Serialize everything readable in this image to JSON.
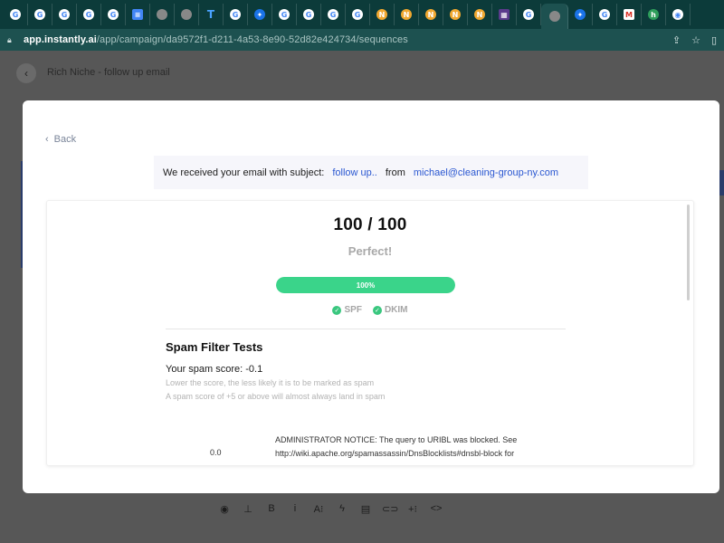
{
  "browser": {
    "tabs": [
      {
        "icon": "google-icon",
        "glyph": "G",
        "kind": "g",
        "text": ""
      },
      {
        "icon": "google-icon",
        "glyph": "G",
        "kind": "g",
        "text": ""
      },
      {
        "icon": "google-icon",
        "glyph": "G",
        "kind": "g",
        "text": ""
      },
      {
        "icon": "google-icon",
        "glyph": "G",
        "kind": "g",
        "text": ""
      },
      {
        "icon": "google-icon",
        "glyph": "G",
        "kind": "g",
        "text": ""
      },
      {
        "icon": "google-docs-icon",
        "glyph": "≡",
        "kind": "gd",
        "text": ""
      },
      {
        "icon": "generic-site-icon",
        "glyph": "",
        "kind": "gray",
        "text": ""
      },
      {
        "icon": "generic-site-icon",
        "glyph": "",
        "kind": "gray",
        "text": ""
      },
      {
        "icon": "t-letter-icon",
        "glyph": "T",
        "kind": "t",
        "text": ""
      },
      {
        "icon": "google-icon",
        "glyph": "G",
        "kind": "g",
        "text": ""
      },
      {
        "icon": "blue-gear-icon",
        "glyph": "✦",
        "kind": "blue",
        "text": ""
      },
      {
        "icon": "google-icon",
        "glyph": "G",
        "kind": "g",
        "text": ""
      },
      {
        "icon": "google-icon",
        "glyph": "G",
        "kind": "g",
        "text": ""
      },
      {
        "icon": "google-icon",
        "glyph": "G",
        "kind": "g",
        "text": ""
      },
      {
        "icon": "google-icon",
        "glyph": "G",
        "kind": "g",
        "text": ""
      },
      {
        "icon": "orange-n-icon",
        "glyph": "N",
        "kind": "orange",
        "text": ""
      },
      {
        "icon": "orange-n-icon",
        "glyph": "N",
        "kind": "orange",
        "text": ""
      },
      {
        "icon": "orange-n-icon",
        "glyph": "N",
        "kind": "orange",
        "text": ""
      },
      {
        "icon": "orange-n-icon",
        "glyph": "N",
        "kind": "orange",
        "text": ""
      },
      {
        "icon": "orange-n-icon",
        "glyph": "N",
        "kind": "orange",
        "text": ""
      },
      {
        "icon": "purple-app-icon",
        "glyph": "▦",
        "kind": "purple",
        "text": ""
      },
      {
        "icon": "google-icon",
        "glyph": "G",
        "kind": "g",
        "text": ""
      },
      {
        "icon": "instantly-icon",
        "glyph": "",
        "kind": "gray",
        "text": "",
        "active": true
      },
      {
        "icon": "blue-gear-icon",
        "glyph": "✦",
        "kind": "blue",
        "text": ""
      },
      {
        "icon": "google-icon",
        "glyph": "G",
        "kind": "g",
        "text": ""
      },
      {
        "icon": "gmail-icon",
        "glyph": "M",
        "kind": "gm",
        "text": ""
      },
      {
        "icon": "green-h-icon",
        "glyph": "h",
        "kind": "green",
        "text": ""
      },
      {
        "icon": "chrome-icon",
        "glyph": "◉",
        "kind": "g",
        "text": ""
      }
    ],
    "url_host": "app.instantly.ai",
    "url_path": "/app/campaign/da9572f1-d211-4a53-8e90-52d82e424734/sequences",
    "share_icon": "share-icon",
    "star_icon": "star-icon"
  },
  "app": {
    "title": "Rich Niche - follow up email",
    "editor_toolbar": [
      {
        "icon": "circle-icon",
        "glyph": "◉"
      },
      {
        "icon": "stamp-icon",
        "glyph": "⊥"
      },
      {
        "icon": "bold-icon",
        "glyph": "B"
      },
      {
        "icon": "italic-icon",
        "glyph": "i"
      },
      {
        "icon": "font-size-icon",
        "glyph": "A⁝"
      },
      {
        "icon": "lightning-icon",
        "glyph": "ϟ"
      },
      {
        "icon": "layout-icon",
        "glyph": "▤"
      },
      {
        "icon": "link-icon",
        "glyph": "⊂⊃"
      },
      {
        "icon": "insert-icon",
        "glyph": "+⁝"
      },
      {
        "icon": "code-icon",
        "glyph": "<>"
      }
    ]
  },
  "modal": {
    "back_label": "Back",
    "received": {
      "prefix": "We received your email with subject:",
      "subject": "follow up..",
      "from_label": "from",
      "from_email": "michael@cleaning-group-ny.com"
    },
    "report": {
      "score": "100 / 100",
      "verdict": "Perfect!",
      "progress_percent": 100,
      "progress_label": "100%",
      "checks": [
        "SPF",
        "DKIM"
      ],
      "spam_title": "Spam Filter Tests",
      "spam_score": "Your spam score: -0.1",
      "note1": "Lower the score, the less likely it is to be marked as spam",
      "note2": "A spam score of +5 or above will almost always land in spam",
      "rule_score": "0.0",
      "rule_desc": "ADMINISTRATOR NOTICE: The query to URIBL was blocked. See http://wiki.apache.org/spamassassin/DnsBlocklists#dnsbl-block for"
    }
  },
  "colors": {
    "accent": "#2a57d1",
    "success": "#3ad48a",
    "browser_chrome": "#0c3b3a"
  }
}
